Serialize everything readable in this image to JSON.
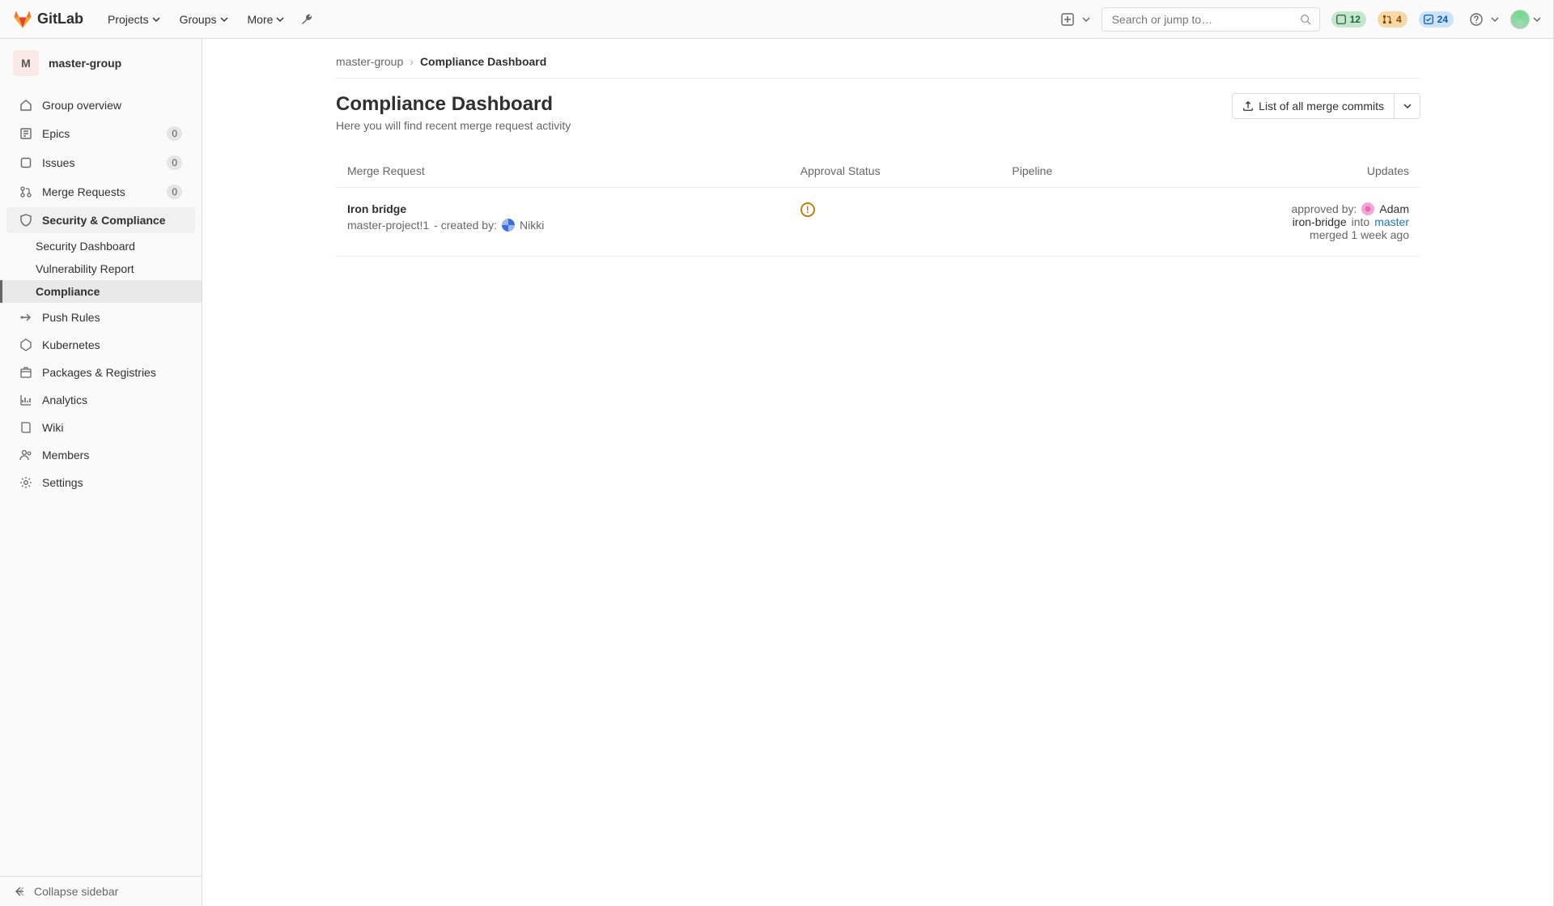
{
  "brand": "GitLab",
  "nav": {
    "items": [
      "Projects",
      "Groups",
      "More"
    ],
    "search_placeholder": "Search or jump to…",
    "counters": {
      "issues": "12",
      "mrs": "4",
      "todos": "24"
    }
  },
  "sidebar": {
    "group_initial": "M",
    "group_name": "master-group",
    "items": [
      {
        "label": "Group overview"
      },
      {
        "label": "Epics",
        "badge": "0"
      },
      {
        "label": "Issues",
        "badge": "0"
      },
      {
        "label": "Merge Requests",
        "badge": "0"
      },
      {
        "label": "Security & Compliance",
        "active": true
      },
      {
        "label": "Push Rules"
      },
      {
        "label": "Kubernetes"
      },
      {
        "label": "Packages & Registries"
      },
      {
        "label": "Analytics"
      },
      {
        "label": "Wiki"
      },
      {
        "label": "Members"
      },
      {
        "label": "Settings"
      }
    ],
    "sub_items": [
      {
        "label": "Security Dashboard"
      },
      {
        "label": "Vulnerability Report"
      },
      {
        "label": "Compliance",
        "selected": true
      }
    ],
    "collapse": "Collapse sidebar"
  },
  "breadcrumbs": {
    "root": "master-group",
    "current": "Compliance Dashboard"
  },
  "page": {
    "title": "Compliance Dashboard",
    "subtitle": "Here you will find recent merge request activity",
    "export_label": "List of all merge commits"
  },
  "table": {
    "headers": {
      "mr": "Merge Request",
      "approval": "Approval Status",
      "pipeline": "Pipeline",
      "updates": "Updates"
    },
    "rows": [
      {
        "title": "Iron bridge",
        "ref": "master-project!1",
        "created_by_prefix": " - created by: ",
        "author": "Nikki",
        "status_icon": "!",
        "approved_prefix": "approved by: ",
        "approver": "Adam",
        "branch_src": "iron-bridge",
        "branch_join": " into ",
        "branch_dst": "master",
        "merged": "merged 1 week ago"
      }
    ]
  }
}
